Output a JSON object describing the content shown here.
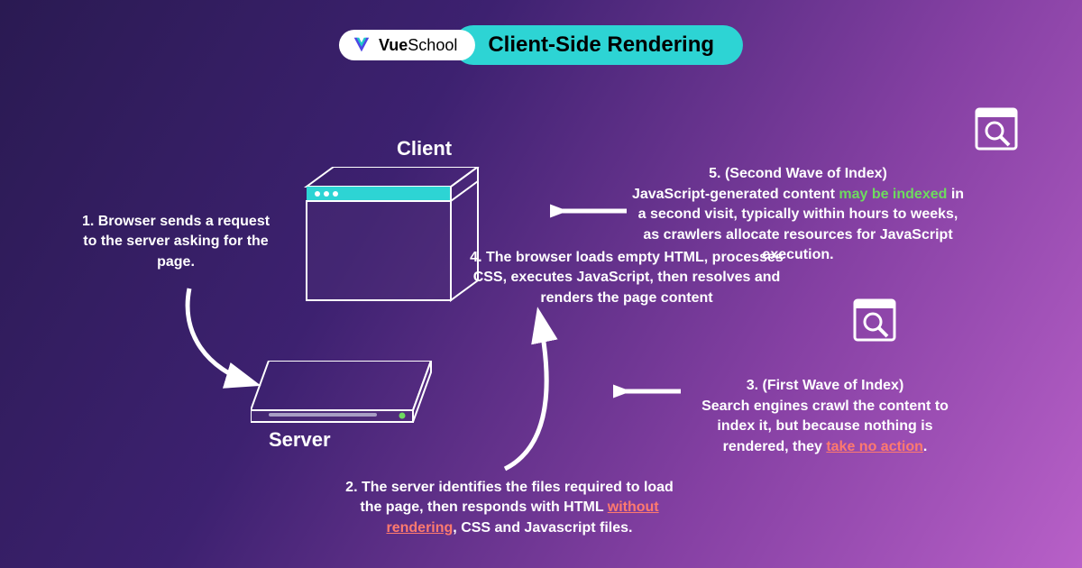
{
  "header": {
    "brand_prefix": "Vue",
    "brand_suffix": " School",
    "title": "Client-Side Rendering"
  },
  "labels": {
    "client": "Client",
    "server": "Server"
  },
  "steps": {
    "s1": "1. Browser sends a request to the server asking for the page.",
    "s2_a": "2. The server identifies the files required to load the page, then responds with HTML ",
    "s2_hl": "without rendering",
    "s2_b": ", CSS and Javascript files.",
    "s3_a": "3. (First Wave of Index)\nSearch engines crawl the content to index it, but because nothing is rendered, they ",
    "s3_hl": "take no action",
    "s3_b": ".",
    "s4": "4. The browser loads empty HTML, processes CSS, executes JavaScript, then resolves and renders the page content",
    "s5_a": "5. (Second Wave of Index)\nJavaScript-generated content ",
    "s5_hl": "may be indexed",
    "s5_b": " in a second visit, typically within hours to weeks, as crawlers allocate resources for JavaScript execution."
  }
}
